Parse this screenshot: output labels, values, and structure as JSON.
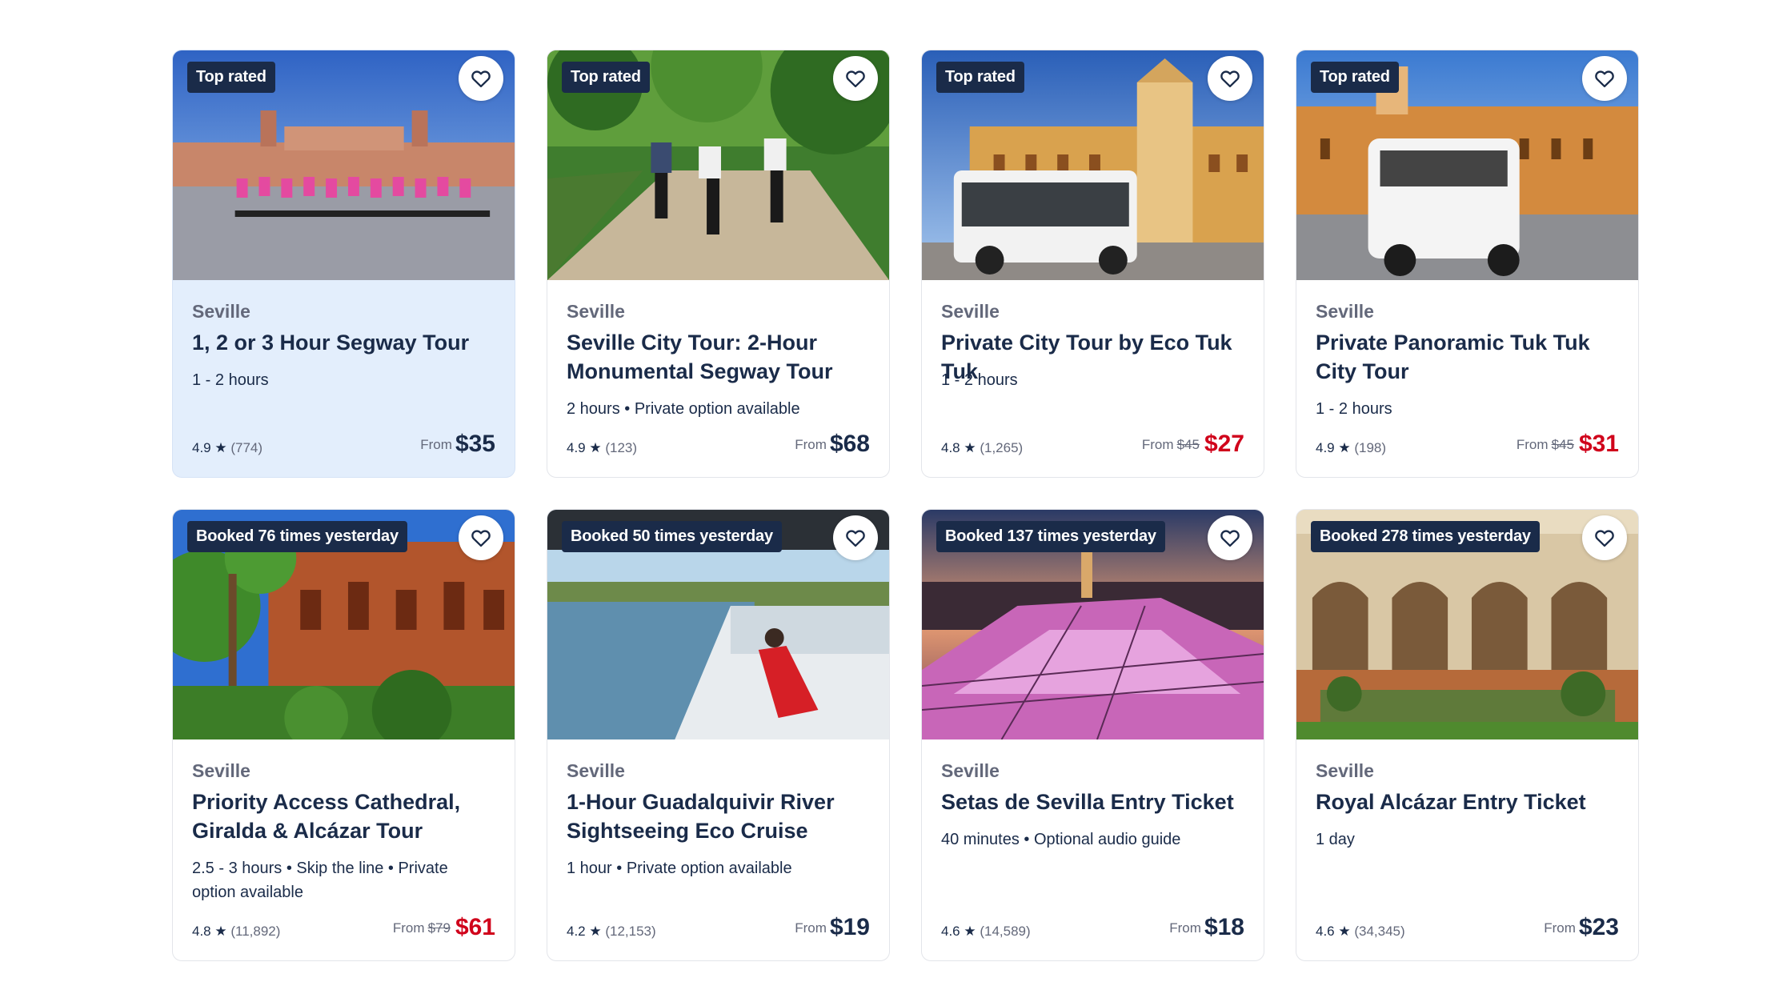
{
  "colors": {
    "navy": "#1a2b49",
    "sale_red": "#d0021b",
    "muted": "#63687a",
    "highlight_bg": "#e3eefc"
  },
  "cards": [
    {
      "badge": "Top rated",
      "location": "Seville",
      "title": "1, 2 or 3 Hour Segway Tour",
      "meta1": "1 - 2 hours",
      "meta2": "",
      "rating": "4.9 ★",
      "reviews": "(774)",
      "from": "From",
      "old_price": "",
      "price": "$35",
      "highlighted": true
    },
    {
      "badge": "Top rated",
      "location": "Seville",
      "title": "Seville City Tour: 2-Hour Monumental Segway Tour",
      "meta1": "",
      "meta2": "2 hours • Private option available",
      "rating": "4.9 ★",
      "reviews": "(123)",
      "from": "From",
      "old_price": "",
      "price": "$68"
    },
    {
      "badge": "Top rated",
      "location": "Seville",
      "title": "Private City Tour by Eco Tuk Tuk",
      "meta1": "1 - 2 hours",
      "meta2": "",
      "rating": "4.8 ★",
      "reviews": "(1,265)",
      "from": "From",
      "old_price": "$45",
      "price": "$27"
    },
    {
      "badge": "Top rated",
      "location": "Seville",
      "title": "Private Panoramic Tuk Tuk City Tour",
      "meta1": "",
      "meta2": "1 - 2 hours",
      "rating": "4.9 ★",
      "reviews": "(198)",
      "from": "From",
      "old_price": "$45",
      "price": "$31"
    },
    {
      "badge": "Booked 76 times yesterday",
      "location": "Seville",
      "title": "Priority Access Cathedral, Giralda & Alcázar Tour",
      "meta1": "",
      "meta2": "2.5 - 3 hours • Skip the line • Private option available",
      "rating": "4.8 ★",
      "reviews": "(11,892)",
      "from": "From",
      "old_price": "$79",
      "price": "$61"
    },
    {
      "badge": "Booked 50 times yesterday",
      "location": "Seville",
      "title": "1-Hour Guadalquivir River Sightseeing Eco Cruise",
      "meta1": "",
      "meta2": "1 hour • Private option available",
      "rating": "4.2 ★",
      "reviews": "(12,153)",
      "from": "From",
      "old_price": "",
      "price": "$19"
    },
    {
      "badge": "Booked 137 times yesterday",
      "location": "Seville",
      "title": "Setas de Sevilla Entry Ticket",
      "meta1": "40 minutes • Optional audio guide",
      "meta2": "",
      "rating": "4.6 ★",
      "reviews": "(14,589)",
      "from": "From",
      "old_price": "",
      "price": "$18"
    },
    {
      "badge": "Booked 278 times yesterday",
      "location": "Seville",
      "title": "Royal Alcázar Entry Ticket",
      "meta1": "1 day",
      "meta2": "",
      "rating": "4.6 ★",
      "reviews": "(34,345)",
      "from": "From",
      "old_price": "",
      "price": "$23"
    }
  ]
}
